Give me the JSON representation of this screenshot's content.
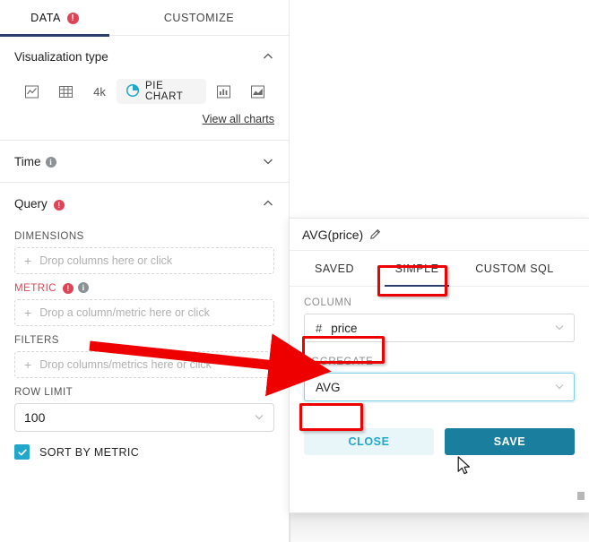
{
  "panel": {
    "tabs": [
      {
        "label": "DATA",
        "badge": "!",
        "active": true
      },
      {
        "label": "CUSTOMIZE",
        "badge": "",
        "active": false
      }
    ],
    "sections": {
      "visualization": {
        "title": "Visualization type",
        "chevron": "chevron-up",
        "items": [
          {
            "name": "line-chart-icon",
            "label": ""
          },
          {
            "name": "table-icon",
            "label": ""
          },
          {
            "name": "big-number-icon",
            "label": "4k"
          },
          {
            "name": "pie-chart-icon",
            "label": "PIE CHART",
            "selected": true
          },
          {
            "name": "bar-chart-icon",
            "label": ""
          },
          {
            "name": "area-chart-icon",
            "label": ""
          }
        ],
        "view_all": "View all charts"
      },
      "time": {
        "title": "Time",
        "chevron": "chevron-down",
        "info": "i"
      },
      "query": {
        "title": "Query",
        "chevron": "chevron-up",
        "badge": "!",
        "dimensions_label": "DIMENSIONS",
        "dimensions_placeholder": "Drop columns here or click",
        "metric_label": "METRIC",
        "metric_placeholder": "Drop a column/metric here or click",
        "filters_label": "FILTERS",
        "filters_placeholder": "Drop columns/metrics here or click",
        "row_limit_label": "ROW LIMIT",
        "row_limit_value": "100",
        "sort_by_metric_label": "SORT BY METRIC",
        "sort_by_metric_checked": true
      }
    }
  },
  "popover": {
    "title": "AVG(price)",
    "edit_icon": "pencil-icon",
    "tabs": [
      {
        "label": "SAVED",
        "active": false
      },
      {
        "label": "SIMPLE",
        "active": true
      },
      {
        "label": "CUSTOM SQL",
        "active": false
      }
    ],
    "column_label": "COLUMN",
    "column_value": "price",
    "column_type_icon": "#",
    "aggregate_label": "AGGREGATE",
    "aggregate_value": "AVG",
    "close_label": "CLOSE",
    "save_label": "SAVE"
  },
  "colors": {
    "accent": "#20a7c9",
    "save_button": "#1a7f9e",
    "tab_underline": "#2c3e6b",
    "error": "#e04355",
    "annotation": "#ee0000"
  }
}
